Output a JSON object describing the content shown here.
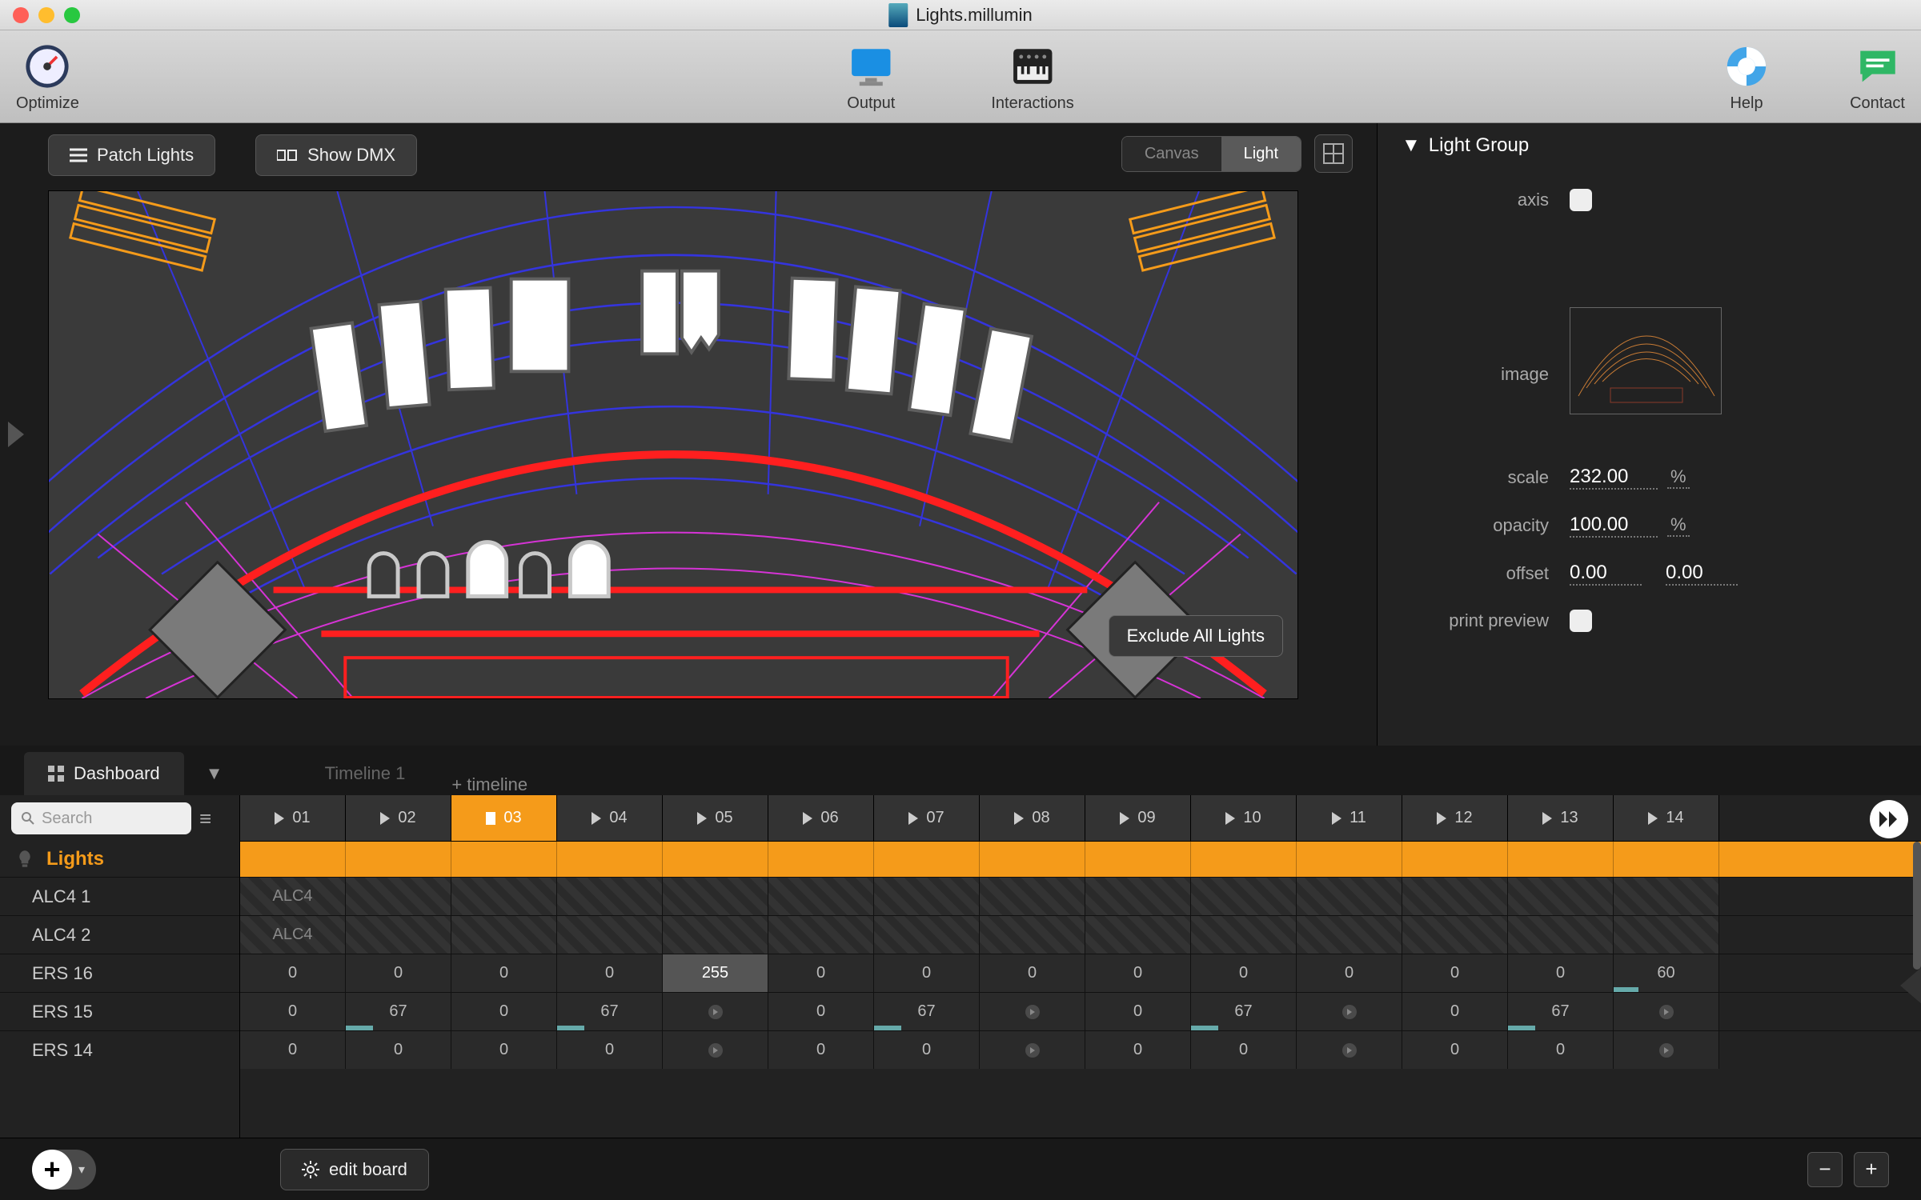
{
  "window": {
    "title": "Lights.millumin"
  },
  "toolbar": {
    "optimize": "Optimize",
    "output": "Output",
    "interactions": "Interactions",
    "help": "Help",
    "contact": "Contact"
  },
  "stage": {
    "patch_lights": "Patch Lights",
    "show_dmx": "Show DMX",
    "seg_canvas": "Canvas",
    "seg_light": "Light",
    "exclude_all": "Exclude All Lights"
  },
  "inspector": {
    "title": "Light Group",
    "axis_label": "axis",
    "axis_checked": false,
    "image_label": "image",
    "scale_label": "scale",
    "scale_value": "232.00",
    "scale_unit": "%",
    "opacity_label": "opacity",
    "opacity_value": "100.00",
    "opacity_unit": "%",
    "offset_label": "offset",
    "offset_x": "0.00",
    "offset_y": "0.00",
    "print_label": "print preview",
    "print_checked": false
  },
  "tabs": {
    "dashboard": "Dashboard",
    "timeline1": "Timeline 1",
    "add_timeline": "+ timeline"
  },
  "board": {
    "search_placeholder": "Search",
    "lights_header": "Lights",
    "columns": [
      "01",
      "02",
      "03",
      "04",
      "05",
      "06",
      "07",
      "08",
      "09",
      "10",
      "11",
      "12",
      "13",
      "14"
    ],
    "active_col": "03",
    "rows": [
      {
        "label": "ALC4  1",
        "type": "hatch",
        "text": "ALC4"
      },
      {
        "label": "ALC4  2",
        "type": "hatch",
        "text": "ALC4"
      },
      {
        "label": "ERS  16",
        "type": "num",
        "values": [
          0,
          0,
          0,
          0,
          255,
          0,
          0,
          0,
          0,
          0,
          0,
          0,
          0,
          60
        ],
        "highlight_idx": 4,
        "bar_idx": 13,
        "bar_pct": 24
      },
      {
        "label": "ERS  15",
        "type": "num",
        "values": [
          0,
          67,
          0,
          67,
          "→",
          0,
          67,
          "→",
          0,
          67,
          "→",
          0,
          67,
          "→"
        ],
        "bars": {
          "1": 26,
          "3": 26,
          "6": 26,
          "9": 26,
          "12": 26
        }
      },
      {
        "label": "ERS  14",
        "type": "num",
        "values": [
          0,
          0,
          0,
          0,
          "→",
          0,
          0,
          "→",
          0,
          0,
          "→",
          0,
          0,
          "→"
        ]
      }
    ]
  },
  "bottom": {
    "edit_board": "edit board"
  }
}
